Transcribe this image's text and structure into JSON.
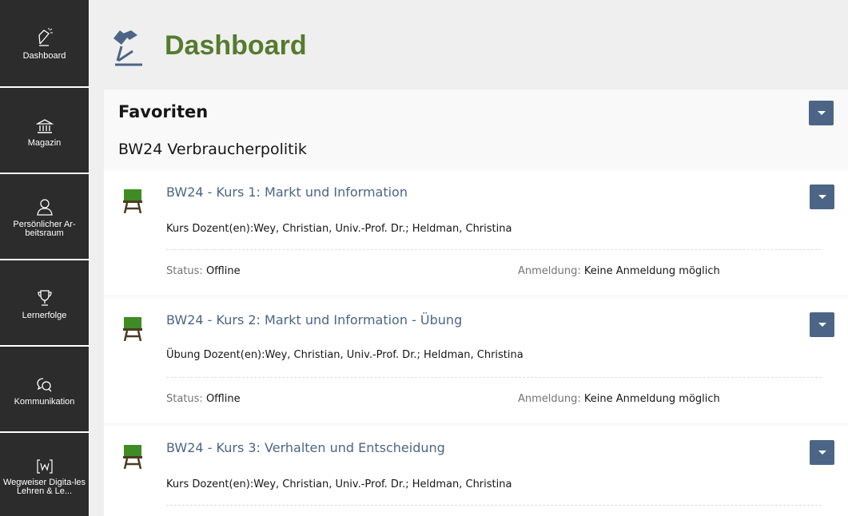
{
  "sidebar": {
    "items": [
      {
        "label": "Dashboard",
        "icon": "desk-lamp-icon"
      },
      {
        "label": "Magazin",
        "icon": "bank-icon"
      },
      {
        "label": "Persönlicher Ar-beitsraum",
        "icon": "person-icon"
      },
      {
        "label": "Lernerfolge",
        "icon": "trophy-icon"
      },
      {
        "label": "Kommunikation",
        "icon": "chat-bubbles-icon"
      },
      {
        "label": "Wegweiser Digita-les Lehren & Le...",
        "icon": "bracket-w-icon"
      }
    ]
  },
  "header": {
    "title": "Dashboard",
    "icon": "desk-lamp-icon"
  },
  "favorites": {
    "title": "Favoriten",
    "group_title": "BW24 Verbraucherpolitik",
    "courses": [
      {
        "title": "BW24 - Kurs 1: Markt und Information",
        "description": "Kurs Dozent(en):Wey, Christian, Univ.-Prof. Dr.; Heldman, Christina",
        "status_key": "Status:",
        "status_value": "Offline",
        "registration_key": "Anmeldung:",
        "registration_value": "Keine Anmeldung möglich"
      },
      {
        "title": "BW24 - Kurs 2: Markt und Information - Übung",
        "description": "Übung Dozent(en):Wey, Christian, Univ.-Prof. Dr.; Heldman, Christina",
        "status_key": "Status:",
        "status_value": "Offline",
        "registration_key": "Anmeldung:",
        "registration_value": "Keine Anmeldung möglich"
      },
      {
        "title": "BW24 - Kurs 3: Verhalten und Entscheidung",
        "description": "Kurs Dozent(en):Wey, Christian, Univ.-Prof. Dr.; Heldman, Christina"
      }
    ]
  },
  "colors": {
    "sidebar_bg": "#2c2c2c",
    "title_green": "#557b2e",
    "link_blue": "#4c6586",
    "course_icon_green": "#3f8b24",
    "course_icon_brown": "#4b3b24"
  }
}
